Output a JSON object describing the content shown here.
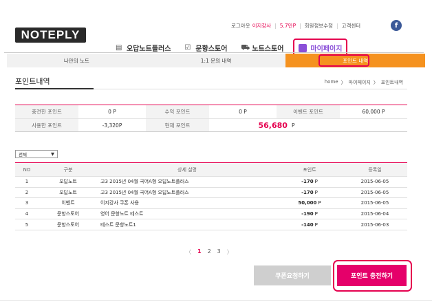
{
  "header": {
    "logo": "NOTEPLY",
    "logout": "로그아웃",
    "user": "이지강사",
    "points": "5.7만P",
    "edit_profile": "회원정보수정",
    "support": "고객센터",
    "facebook": "f"
  },
  "gnb": {
    "items": [
      "오답노트플러스",
      "문항스토어",
      "노트스토어"
    ],
    "mypage": "마이페이지"
  },
  "subtabs": [
    "나만의 노트",
    "1:1 문의 내역",
    "포인트 내역"
  ],
  "page_title": "포인트내역",
  "breadcrumb": [
    "home",
    "마이페이지",
    "포인트내역"
  ],
  "summary": {
    "row1": [
      {
        "label": "충전한 포인트",
        "value": "0 P"
      },
      {
        "label": "수익 포인트",
        "value": "0 P"
      },
      {
        "label": "이벤트 포인트",
        "value": "60,000 P"
      }
    ],
    "row2": [
      {
        "label": "사용한 포인트",
        "value": "-3,320P"
      },
      {
        "label": "현재 포인트",
        "value": "56,680",
        "unit": "P"
      }
    ]
  },
  "filter": {
    "selected": "전체"
  },
  "list": {
    "headers": [
      "NO",
      "구분",
      "상세 설명",
      "포인트",
      "등록일"
    ],
    "rows": [
      {
        "no": "1",
        "type": "오답노트",
        "desc": "고3 2015년 04월 국어A형 오답노트플러스",
        "points": "-170",
        "unit": "P",
        "date": "2015-06-05"
      },
      {
        "no": "2",
        "type": "오답노트",
        "desc": "고3 2015년 04월 국어A형 오답노트플러스",
        "points": "-170",
        "unit": "P",
        "date": "2015-06-05"
      },
      {
        "no": "3",
        "type": "이벤트",
        "desc": "이지강사 쿠폰 사용",
        "points": "50,000",
        "unit": "P",
        "date": "2015-06-05"
      },
      {
        "no": "4",
        "type": "문항스토어",
        "desc": "영어 문항노트 테스트",
        "points": "-190",
        "unit": "P",
        "date": "2015-06-04"
      },
      {
        "no": "5",
        "type": "문항스토어",
        "desc": "테스트 문항노트1",
        "points": "-140",
        "unit": "P",
        "date": "2015-06-03"
      }
    ]
  },
  "pager": {
    "prev": "〈",
    "pages": [
      "1",
      "2",
      "3"
    ],
    "next": "〉"
  },
  "buttons": {
    "coupon": "쿠폰요청하기",
    "charge": "포인트 충전하기"
  }
}
